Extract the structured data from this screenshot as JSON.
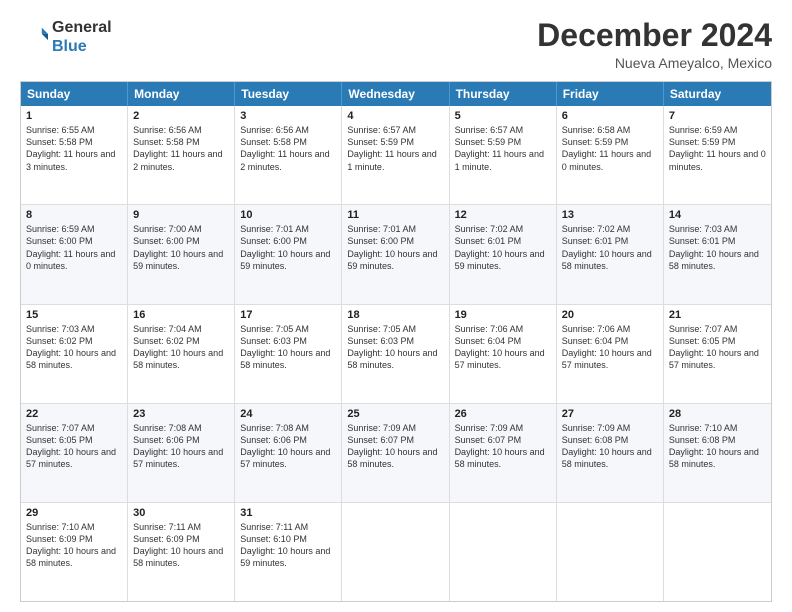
{
  "logo": {
    "general": "General",
    "blue": "Blue"
  },
  "title": "December 2024",
  "location": "Nueva Ameyalco, Mexico",
  "days": [
    "Sunday",
    "Monday",
    "Tuesday",
    "Wednesday",
    "Thursday",
    "Friday",
    "Saturday"
  ],
  "weeks": [
    {
      "alt": false,
      "cells": [
        {
          "day": "1",
          "sunrise": "Sunrise: 6:55 AM",
          "sunset": "Sunset: 5:58 PM",
          "daylight": "Daylight: 11 hours and 3 minutes."
        },
        {
          "day": "2",
          "sunrise": "Sunrise: 6:56 AM",
          "sunset": "Sunset: 5:58 PM",
          "daylight": "Daylight: 11 hours and 2 minutes."
        },
        {
          "day": "3",
          "sunrise": "Sunrise: 6:56 AM",
          "sunset": "Sunset: 5:58 PM",
          "daylight": "Daylight: 11 hours and 2 minutes."
        },
        {
          "day": "4",
          "sunrise": "Sunrise: 6:57 AM",
          "sunset": "Sunset: 5:59 PM",
          "daylight": "Daylight: 11 hours and 1 minute."
        },
        {
          "day": "5",
          "sunrise": "Sunrise: 6:57 AM",
          "sunset": "Sunset: 5:59 PM",
          "daylight": "Daylight: 11 hours and 1 minute."
        },
        {
          "day": "6",
          "sunrise": "Sunrise: 6:58 AM",
          "sunset": "Sunset: 5:59 PM",
          "daylight": "Daylight: 11 hours and 0 minutes."
        },
        {
          "day": "7",
          "sunrise": "Sunrise: 6:59 AM",
          "sunset": "Sunset: 5:59 PM",
          "daylight": "Daylight: 11 hours and 0 minutes."
        }
      ]
    },
    {
      "alt": true,
      "cells": [
        {
          "day": "8",
          "sunrise": "Sunrise: 6:59 AM",
          "sunset": "Sunset: 6:00 PM",
          "daylight": "Daylight: 11 hours and 0 minutes."
        },
        {
          "day": "9",
          "sunrise": "Sunrise: 7:00 AM",
          "sunset": "Sunset: 6:00 PM",
          "daylight": "Daylight: 10 hours and 59 minutes."
        },
        {
          "day": "10",
          "sunrise": "Sunrise: 7:01 AM",
          "sunset": "Sunset: 6:00 PM",
          "daylight": "Daylight: 10 hours and 59 minutes."
        },
        {
          "day": "11",
          "sunrise": "Sunrise: 7:01 AM",
          "sunset": "Sunset: 6:00 PM",
          "daylight": "Daylight: 10 hours and 59 minutes."
        },
        {
          "day": "12",
          "sunrise": "Sunrise: 7:02 AM",
          "sunset": "Sunset: 6:01 PM",
          "daylight": "Daylight: 10 hours and 59 minutes."
        },
        {
          "day": "13",
          "sunrise": "Sunrise: 7:02 AM",
          "sunset": "Sunset: 6:01 PM",
          "daylight": "Daylight: 10 hours and 58 minutes."
        },
        {
          "day": "14",
          "sunrise": "Sunrise: 7:03 AM",
          "sunset": "Sunset: 6:01 PM",
          "daylight": "Daylight: 10 hours and 58 minutes."
        }
      ]
    },
    {
      "alt": false,
      "cells": [
        {
          "day": "15",
          "sunrise": "Sunrise: 7:03 AM",
          "sunset": "Sunset: 6:02 PM",
          "daylight": "Daylight: 10 hours and 58 minutes."
        },
        {
          "day": "16",
          "sunrise": "Sunrise: 7:04 AM",
          "sunset": "Sunset: 6:02 PM",
          "daylight": "Daylight: 10 hours and 58 minutes."
        },
        {
          "day": "17",
          "sunrise": "Sunrise: 7:05 AM",
          "sunset": "Sunset: 6:03 PM",
          "daylight": "Daylight: 10 hours and 58 minutes."
        },
        {
          "day": "18",
          "sunrise": "Sunrise: 7:05 AM",
          "sunset": "Sunset: 6:03 PM",
          "daylight": "Daylight: 10 hours and 58 minutes."
        },
        {
          "day": "19",
          "sunrise": "Sunrise: 7:06 AM",
          "sunset": "Sunset: 6:04 PM",
          "daylight": "Daylight: 10 hours and 57 minutes."
        },
        {
          "day": "20",
          "sunrise": "Sunrise: 7:06 AM",
          "sunset": "Sunset: 6:04 PM",
          "daylight": "Daylight: 10 hours and 57 minutes."
        },
        {
          "day": "21",
          "sunrise": "Sunrise: 7:07 AM",
          "sunset": "Sunset: 6:05 PM",
          "daylight": "Daylight: 10 hours and 57 minutes."
        }
      ]
    },
    {
      "alt": true,
      "cells": [
        {
          "day": "22",
          "sunrise": "Sunrise: 7:07 AM",
          "sunset": "Sunset: 6:05 PM",
          "daylight": "Daylight: 10 hours and 57 minutes."
        },
        {
          "day": "23",
          "sunrise": "Sunrise: 7:08 AM",
          "sunset": "Sunset: 6:06 PM",
          "daylight": "Daylight: 10 hours and 57 minutes."
        },
        {
          "day": "24",
          "sunrise": "Sunrise: 7:08 AM",
          "sunset": "Sunset: 6:06 PM",
          "daylight": "Daylight: 10 hours and 57 minutes."
        },
        {
          "day": "25",
          "sunrise": "Sunrise: 7:09 AM",
          "sunset": "Sunset: 6:07 PM",
          "daylight": "Daylight: 10 hours and 58 minutes."
        },
        {
          "day": "26",
          "sunrise": "Sunrise: 7:09 AM",
          "sunset": "Sunset: 6:07 PM",
          "daylight": "Daylight: 10 hours and 58 minutes."
        },
        {
          "day": "27",
          "sunrise": "Sunrise: 7:09 AM",
          "sunset": "Sunset: 6:08 PM",
          "daylight": "Daylight: 10 hours and 58 minutes."
        },
        {
          "day": "28",
          "sunrise": "Sunrise: 7:10 AM",
          "sunset": "Sunset: 6:08 PM",
          "daylight": "Daylight: 10 hours and 58 minutes."
        }
      ]
    },
    {
      "alt": false,
      "cells": [
        {
          "day": "29",
          "sunrise": "Sunrise: 7:10 AM",
          "sunset": "Sunset: 6:09 PM",
          "daylight": "Daylight: 10 hours and 58 minutes."
        },
        {
          "day": "30",
          "sunrise": "Sunrise: 7:11 AM",
          "sunset": "Sunset: 6:09 PM",
          "daylight": "Daylight: 10 hours and 58 minutes."
        },
        {
          "day": "31",
          "sunrise": "Sunrise: 7:11 AM",
          "sunset": "Sunset: 6:10 PM",
          "daylight": "Daylight: 10 hours and 59 minutes."
        },
        null,
        null,
        null,
        null
      ]
    }
  ]
}
